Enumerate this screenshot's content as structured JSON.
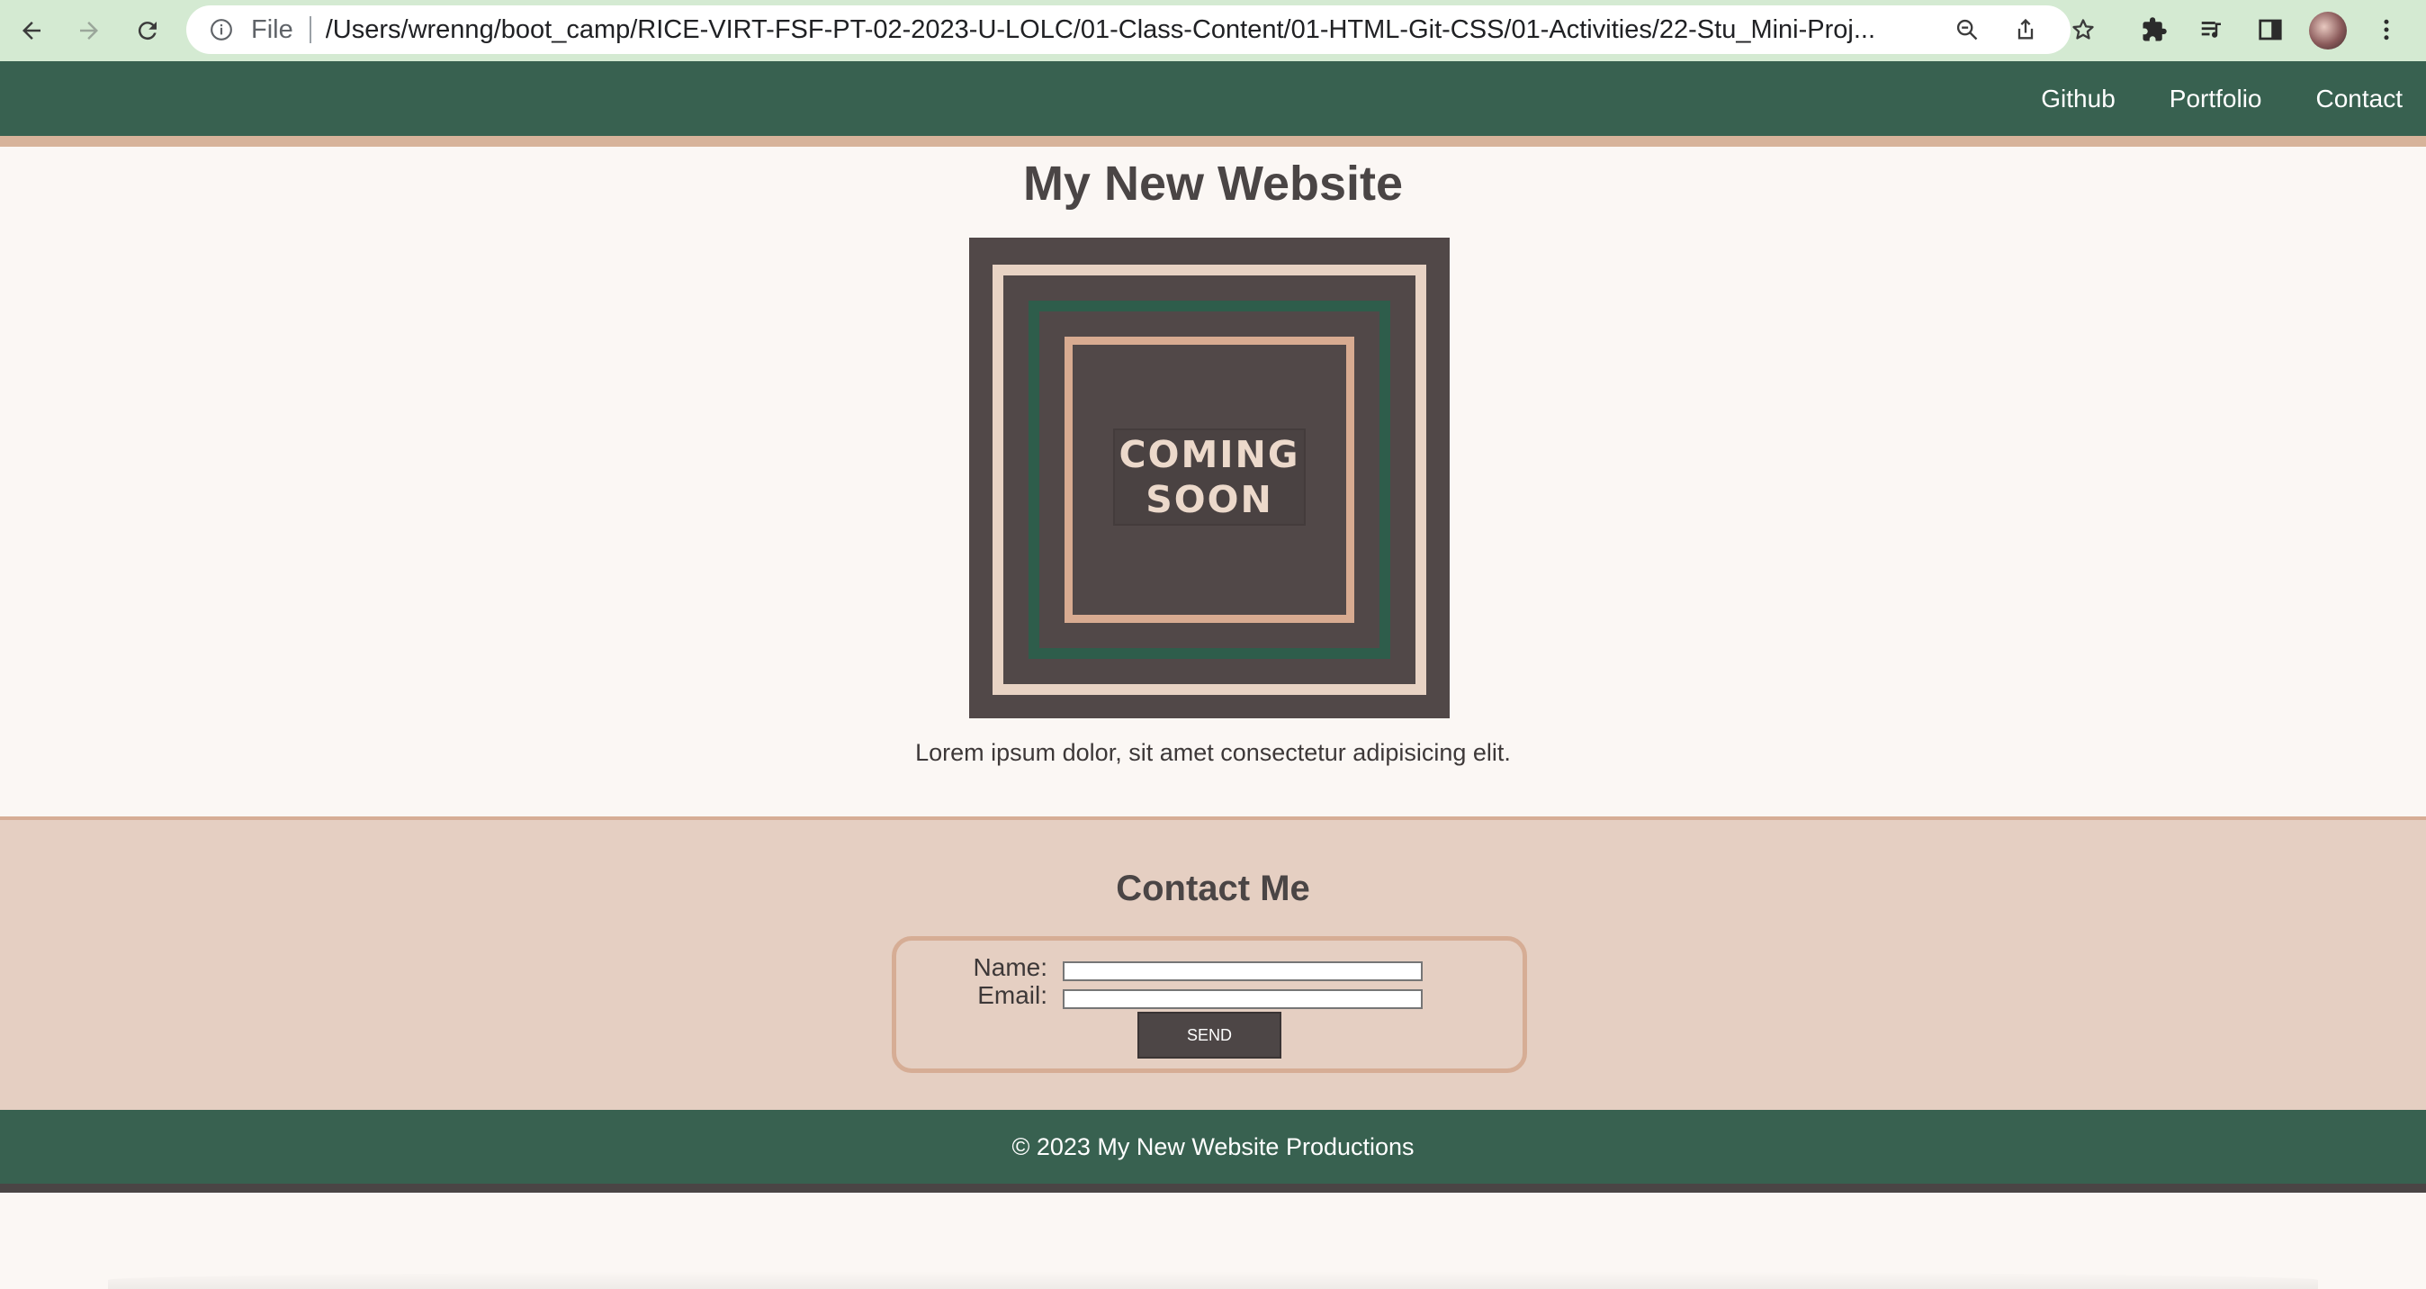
{
  "browser": {
    "file_label": "File",
    "url": "/Users/wrenng/boot_camp/RICE-VIRT-FSF-PT-02-2023-U-LOLC/01-Class-Content/01-HTML-Git-CSS/01-Activities/22-Stu_Mini-Proj..."
  },
  "header": {
    "nav": [
      "Github",
      "Portfolio",
      "Contact"
    ]
  },
  "main": {
    "title": "My New Website",
    "image_text_line1": "COMING",
    "image_text_line2": "SOON",
    "description": "Lorem ipsum dolor, sit amet consectetur adipisicing elit."
  },
  "contact": {
    "title": "Contact Me",
    "name_label": "Name:",
    "email_label": "Email:",
    "name_value": "",
    "email_value": "",
    "send_label": "SEND"
  },
  "footer": {
    "text": "© 2023 My New Website Productions"
  },
  "colors": {
    "header_bg": "#386150",
    "accent_tan": "#d7b39a",
    "contact_bg": "#e5cfc2",
    "page_bg": "#fbf7f4",
    "text_dark": "#4a4545"
  }
}
